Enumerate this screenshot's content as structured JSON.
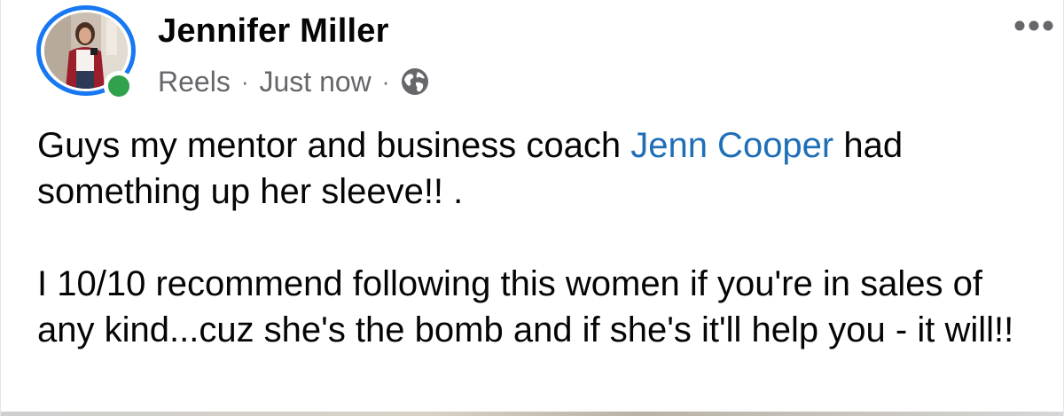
{
  "post": {
    "author": {
      "name": "Jennifer Miller",
      "online": true,
      "ring_color": "#1877f2",
      "online_color": "#31a24c"
    },
    "meta": {
      "source": "Reels",
      "time": "Just now",
      "separator": "·",
      "audience_icon": "globe-icon"
    },
    "menu_icon": "more-options-icon",
    "text": {
      "p1_before": "Guys my mentor and business coach ",
      "mention": "Jenn Cooper",
      "p1_after": " had something up her sleeve!! .",
      "p2": "I 10/10 recommend following this women if you're in sales of any kind...cuz she's the bomb and if she's it'll help you - it will!!"
    },
    "colors": {
      "mention": "#1f6fb8",
      "secondary_text": "#65676b",
      "primary_text": "#050505"
    }
  }
}
